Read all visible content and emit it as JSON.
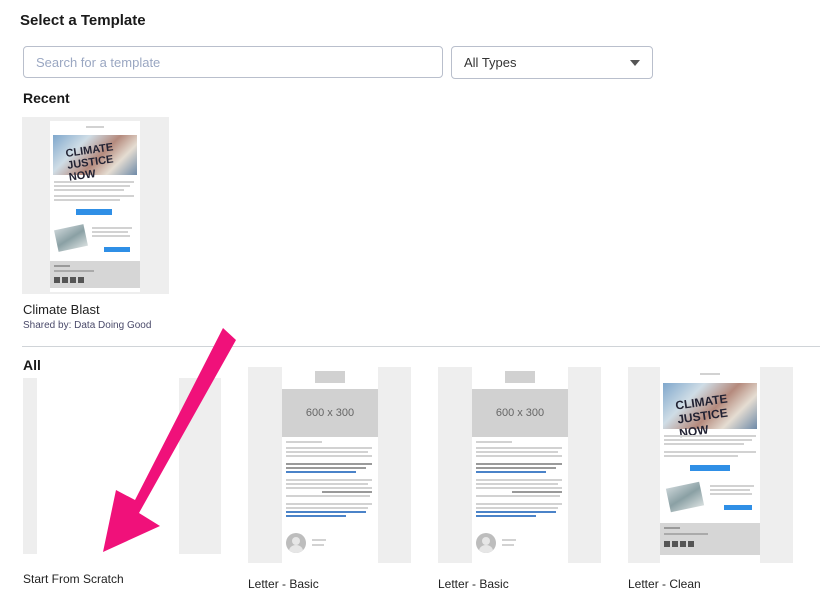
{
  "header": {
    "title": "Select a Template"
  },
  "search": {
    "placeholder": "Search for a template",
    "value": ""
  },
  "type_filter": {
    "selected": "All Types"
  },
  "recent": {
    "heading": "Recent",
    "items": [
      {
        "name": "Climate Blast",
        "shared_by": "Shared by: Data Doing Good",
        "hero_text": "CLIMATE JUSTICE NOW"
      }
    ]
  },
  "all": {
    "heading": "All",
    "items": [
      {
        "name": "Start From Scratch"
      },
      {
        "name": "Letter - Basic",
        "image_placeholder": "600 x 300"
      },
      {
        "name": "Letter - Basic",
        "image_placeholder": "600 x 300"
      },
      {
        "name": "Letter - Clean",
        "hero_text": "CLIMATE JUSTICE NOW"
      }
    ]
  },
  "colors": {
    "annotation_arrow": "#f0117a",
    "accent_blue": "#2f8fe6"
  }
}
